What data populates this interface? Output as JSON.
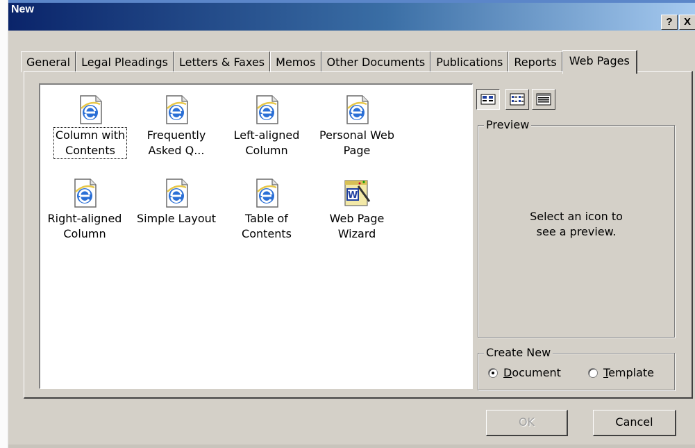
{
  "window": {
    "title": "New",
    "help_button": "?",
    "close_button": "X"
  },
  "tabs": [
    {
      "label": "General",
      "active": false
    },
    {
      "label": "Legal Pleadings",
      "active": false
    },
    {
      "label": "Letters & Faxes",
      "active": false
    },
    {
      "label": "Memos",
      "active": false
    },
    {
      "label": "Other Documents",
      "active": false
    },
    {
      "label": "Publications",
      "active": false
    },
    {
      "label": "Reports",
      "active": false
    },
    {
      "label": "Web Pages",
      "active": true
    }
  ],
  "templates": [
    {
      "line1": "Column with",
      "line2": "Contents",
      "icon": "ie-page-icon",
      "focused": true
    },
    {
      "line1": "Frequently",
      "line2": "Asked Q...",
      "icon": "ie-page-icon",
      "focused": false
    },
    {
      "line1": "Left-aligned",
      "line2": "Column",
      "icon": "ie-page-icon",
      "focused": false
    },
    {
      "line1": "Personal Web",
      "line2": "Page",
      "icon": "ie-page-icon",
      "focused": false
    },
    {
      "line1": "Right-aligned",
      "line2": "Column",
      "icon": "ie-page-icon",
      "focused": false
    },
    {
      "line1": "Simple Layout",
      "line2": "",
      "icon": "ie-page-icon",
      "focused": false
    },
    {
      "line1": "Table of",
      "line2": "Contents",
      "icon": "ie-page-icon",
      "focused": false
    },
    {
      "line1": "Web Page",
      "line2": "Wizard",
      "icon": "word-wizard-icon",
      "focused": false
    }
  ],
  "view_buttons": [
    {
      "name": "large-icons-view-icon",
      "pressed": true
    },
    {
      "name": "list-view-icon",
      "pressed": false
    },
    {
      "name": "details-view-icon",
      "pressed": false
    }
  ],
  "preview": {
    "legend": "Preview",
    "line1": "Select an icon to",
    "line2": "see a preview."
  },
  "create_new": {
    "legend": "Create New",
    "document_key": "D",
    "document_rest": "ocument",
    "template_key": "T",
    "template_rest": "emplate",
    "selected": "Document"
  },
  "buttons": {
    "ok": "OK",
    "cancel": "Cancel"
  },
  "colors": {
    "dialog_face": "#d4d0c8",
    "title_start": "#0a246a",
    "title_end": "#a6caf0",
    "ie_blue": "#1f5fcf"
  }
}
